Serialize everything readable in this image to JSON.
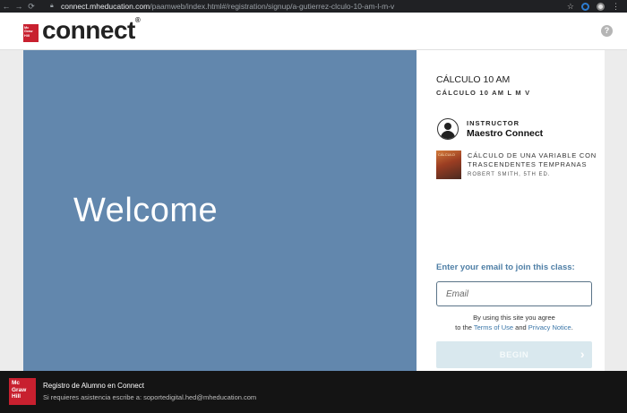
{
  "browser": {
    "url_host": "connect.mheducation.com",
    "url_path": "/paamweb/index.html#/registration/signup/a-gutierrez-clculo-10-am-l-m-v"
  },
  "header": {
    "logo_text": "Mc Graw Hill",
    "app_name": "connect",
    "registered_mark": "®",
    "help_label": "?"
  },
  "welcome": {
    "title": "Welcome",
    "background_color": "#6287ad"
  },
  "course": {
    "title": "CÁLCULO 10 AM",
    "section": "CÁLCULO 10 AM L M V",
    "instructor_label": "INSTRUCTOR",
    "instructor_name": "Maestro Connect",
    "book_cover_text": "CÁLCULO",
    "book_title": "CÁLCULO DE UNA VARIABLE CON TRASCENDENTES TEMPRANAS",
    "book_author": "ROBERT SMITH, 5TH ED."
  },
  "signup": {
    "join_label": "Enter your email to join this class:",
    "email_placeholder": "Email",
    "email_value": "",
    "terms_prefix": "By using this site you agree",
    "terms_to": "to the",
    "terms_link": "Terms of Use",
    "terms_and": "and",
    "privacy_link": "Privacy Notice",
    "terms_suffix": ".",
    "begin_label": "BEGIN",
    "accent_color": "#4f7fa6"
  },
  "footer": {
    "logo_text": "Mc Graw Hill",
    "title": "Registro de Alumno en Connect",
    "help_text": "Si requieres asistencia escribe a: soportedigital.hed@mheducation.com",
    "brand_color": "#c8202f"
  }
}
